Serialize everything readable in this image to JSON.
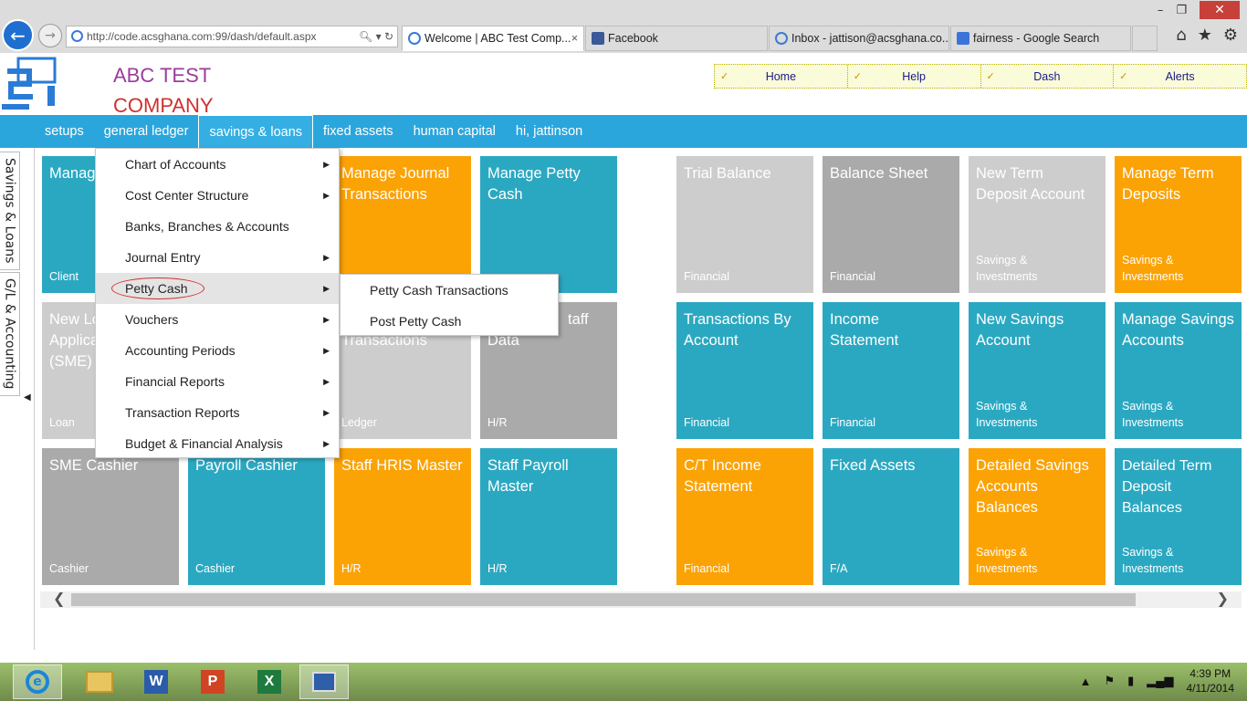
{
  "browser": {
    "url": "http://code.acsghana.com:99/dash/default.aspx",
    "tabs": [
      {
        "label": "Welcome | ABC Test Comp...",
        "close": "×"
      },
      {
        "label": "Facebook"
      },
      {
        "label": "Inbox - jattison@acsghana.co..."
      },
      {
        "label": "fairness - Google Search"
      }
    ],
    "window_controls": {
      "minimize": "–",
      "restore": "❐",
      "close": "✕"
    },
    "toolbar_icons": {
      "home": "⌂",
      "favorites": "★",
      "settings": "⚙"
    }
  },
  "header": {
    "company_line1": "ABC TEST",
    "company_line2": "COMPANY",
    "top_links": [
      {
        "label": "Home"
      },
      {
        "label": "Help"
      },
      {
        "label": "Dash"
      },
      {
        "label": "Alerts"
      }
    ]
  },
  "nav": {
    "items": [
      {
        "label": "setups"
      },
      {
        "label": "general ledger"
      },
      {
        "label": "savings & loans"
      },
      {
        "label": "fixed assets"
      },
      {
        "label": "human capital"
      },
      {
        "label": "hi, jattinson"
      }
    ]
  },
  "side_tabs": [
    "Savings & Loans",
    "G/L & Accounting"
  ],
  "menu": {
    "items": [
      {
        "label": "Chart of Accounts",
        "has_sub": true
      },
      {
        "label": "Cost Center Structure",
        "has_sub": true
      },
      {
        "label": "Banks, Branches & Accounts",
        "has_sub": false
      },
      {
        "label": "Journal Entry",
        "has_sub": true
      },
      {
        "label": "Petty Cash",
        "has_sub": true
      },
      {
        "label": "Vouchers",
        "has_sub": true
      },
      {
        "label": "Accounting Periods",
        "has_sub": true
      },
      {
        "label": "Financial Reports",
        "has_sub": true
      },
      {
        "label": "Transaction Reports",
        "has_sub": true
      },
      {
        "label": "Budget & Financial Analysis",
        "has_sub": true
      }
    ],
    "submenu": [
      {
        "label": "Petty Cash Transactions"
      },
      {
        "label": "Post Petty Cash"
      }
    ]
  },
  "tiles": [
    {
      "title": "Manag Data",
      "category": "Client",
      "color": "teal"
    },
    {
      "title": "Manage Journal Transactions",
      "category": "",
      "color": "orange"
    },
    {
      "title": "Manage Petty Cash",
      "category": "",
      "color": "teal"
    },
    {
      "title": "Trial Balance",
      "category": "Financial",
      "color": "lgray"
    },
    {
      "title": "Balance Sheet",
      "category": "Financial",
      "color": "gray"
    },
    {
      "title": "New Term Deposit Account",
      "category": "Savings & Investments",
      "color": "lgray"
    },
    {
      "title": "Manage Term Deposits",
      "category": "Savings & Investments",
      "color": "orange"
    },
    {
      "title": "New Lo Applica (SME)",
      "category": "Loan",
      "color": "lgray"
    },
    {
      "title": "Transactions",
      "category": "Ledger",
      "color": "lgray"
    },
    {
      "title": "Data",
      "title_right": "taff",
      "category": "H/R",
      "color": "gray"
    },
    {
      "title": "Transactions By Account",
      "category": "Financial",
      "color": "teal"
    },
    {
      "title": "Income Statement",
      "category": "Financial",
      "color": "teal"
    },
    {
      "title": "New Savings Account",
      "category": "Savings & Investments",
      "color": "teal"
    },
    {
      "title": "Manage Savings Accounts",
      "category": "Savings & Investments",
      "color": "teal"
    },
    {
      "title": "SME Cashier",
      "category": "Cashier",
      "color": "gray"
    },
    {
      "title": "Payroll Cashier",
      "category": "Cashier",
      "color": "teal"
    },
    {
      "title": "Staff HRIS Master",
      "category": "H/R",
      "color": "orange"
    },
    {
      "title": "Staff Payroll Master",
      "category": "H/R",
      "color": "teal"
    },
    {
      "title": "C/T Income Statement",
      "category": "Financial",
      "color": "orange"
    },
    {
      "title": "Fixed Assets",
      "category": "F/A",
      "color": "teal"
    },
    {
      "title": "Detailed Savings Accounts Balances",
      "category": "Savings & Investments",
      "color": "orange"
    },
    {
      "title": "Detailed Term Deposit Balances",
      "category": "Savings & Investments",
      "color": "teal"
    }
  ],
  "taskbar": {
    "apps": [
      {
        "name": "internet-explorer",
        "glyph": "e"
      },
      {
        "name": "file-explorer"
      },
      {
        "name": "word",
        "glyph": "W"
      },
      {
        "name": "powerpoint",
        "glyph": "P"
      },
      {
        "name": "excel",
        "glyph": "X"
      },
      {
        "name": "remote-desktop"
      }
    ],
    "time": "4:39 PM",
    "date": "4/11/2014"
  }
}
